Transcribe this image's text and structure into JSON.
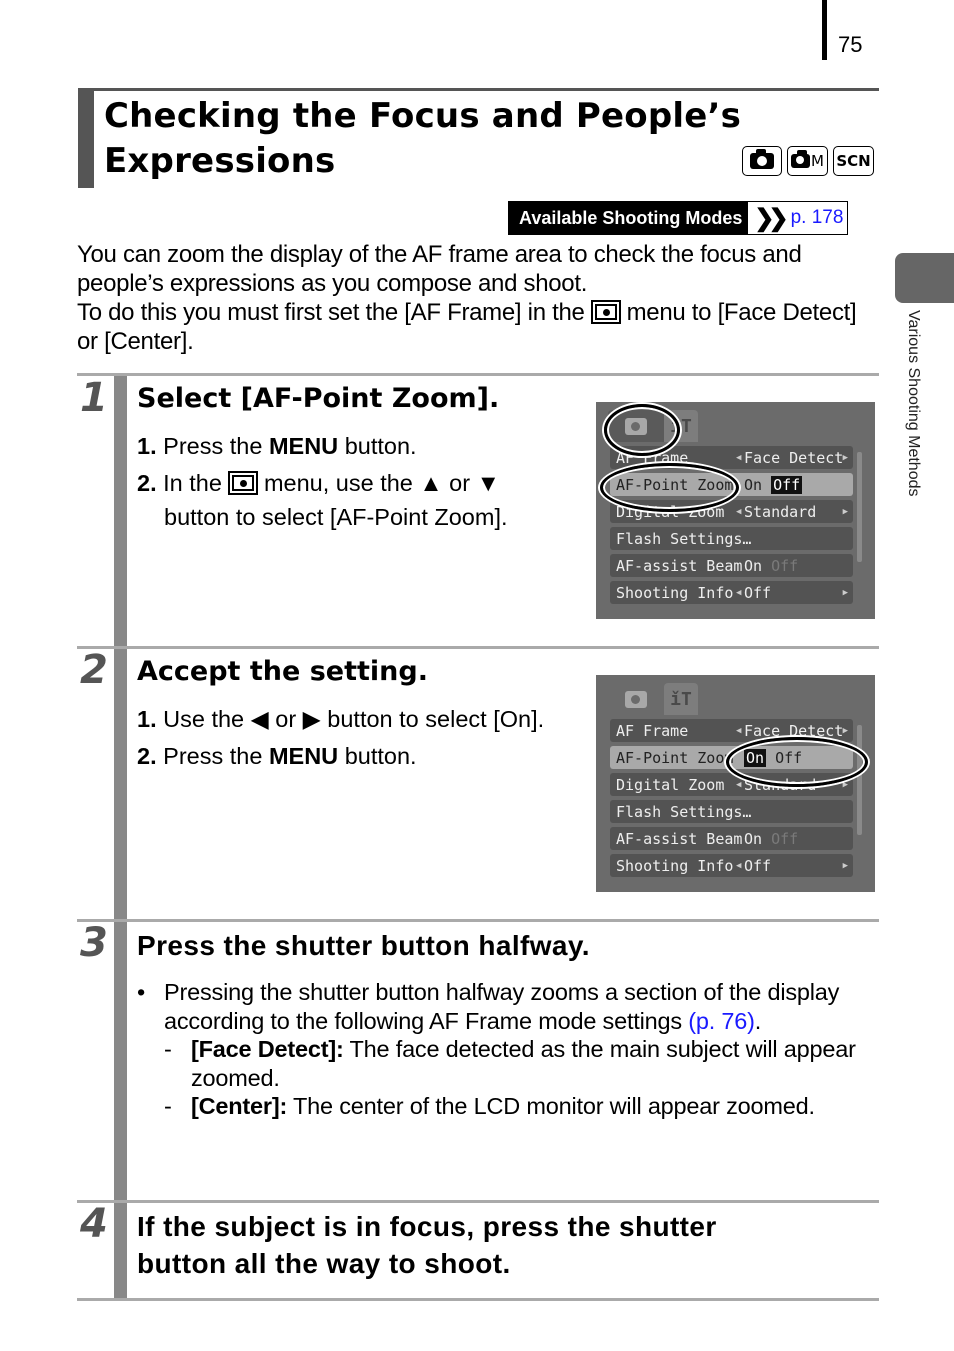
{
  "page": {
    "number": "75",
    "side_tab_label": "Various Shooting Methods"
  },
  "header": {
    "title_line1": "Checking the Focus and People’s",
    "title_line2": "Expressions",
    "mode_icons": [
      {
        "icon": "camera-auto-icon",
        "label": ""
      },
      {
        "icon": "camera-manual-icon",
        "label": "M"
      },
      {
        "icon": "scene-mode-icon",
        "label": "SCN"
      }
    ],
    "available_modes_label": "Available Shooting Modes",
    "available_modes_ref": "p. 178"
  },
  "intro": {
    "para1": "You can zoom the display of the AF frame area to check the focus and people’s expressions as you compose and shoot.",
    "para2_before": "To do this you must first set the [AF Frame] in the",
    "para2_after": "menu to [Face Detect] or [Center]."
  },
  "steps": [
    {
      "number": "1",
      "title": "Select [AF-Point Zoom].",
      "substeps": [
        {
          "num": "1.",
          "before": "Press the",
          "bold": "MENU",
          "after": "button."
        },
        {
          "num": "2.",
          "before": "In the",
          "mid": "menu, use the ▲ or ▼",
          "line2": "button to select [AF-Point Zoom]."
        }
      ]
    },
    {
      "number": "2",
      "title": "Accept the setting.",
      "substeps": [
        {
          "num": "1.",
          "text": "Use the ◀ or ▶ button to select [On]."
        },
        {
          "num": "2.",
          "before": "Press the",
          "bold": "MENU",
          "after": "button."
        }
      ]
    },
    {
      "number": "3",
      "title": "Press the shutter button halfway.",
      "bullet": "Pressing the shutter button halfway zooms a section of the display according to the following AF Frame mode settings",
      "bullet_ref": "(p. 76)",
      "sub_items": [
        {
          "label": "[Face Detect]:",
          "text": "The face detected as the main subject will appear zoomed."
        },
        {
          "label": "[Center]:",
          "text": "The center of the LCD monitor will appear zoomed."
        }
      ]
    },
    {
      "number": "4",
      "title_line1": "If the subject is in focus, press the shutter",
      "title_line2": "button all the way to shoot."
    }
  ],
  "screens": [
    {
      "tabs": [
        "camera-tab",
        "setup-tab"
      ],
      "setup_tab_glyph": "ǐT",
      "rows": [
        {
          "label": "AF Frame",
          "value": "Face Detect"
        },
        {
          "label": "AF-Point Zoom",
          "value_on": "On",
          "value_off": "Off",
          "selected_option": "Off"
        },
        {
          "label": "Digital Zoom",
          "value": "Standard"
        },
        {
          "label": "Flash Settings…",
          "value": ""
        },
        {
          "label": "AF-assist Beam",
          "value_on": "On",
          "value_off": "Off"
        },
        {
          "label": "Shooting Info",
          "value": "Off"
        }
      ]
    },
    {
      "tabs": [
        "camera-tab",
        "setup-tab"
      ],
      "setup_tab_glyph": "ǐT",
      "rows": [
        {
          "label": "AF Frame",
          "value": "Face Detect"
        },
        {
          "label": "AF-Point Zoom",
          "value_on": "On",
          "value_off": "Off",
          "selected_option": "On"
        },
        {
          "label": "Digital Zoom",
          "value": "Standard"
        },
        {
          "label": "Flash Settings…",
          "value": ""
        },
        {
          "label": "AF-assist Beam",
          "value_on": "On",
          "value_off": "Off"
        },
        {
          "label": "Shooting Info",
          "value": "Off"
        }
      ]
    }
  ]
}
